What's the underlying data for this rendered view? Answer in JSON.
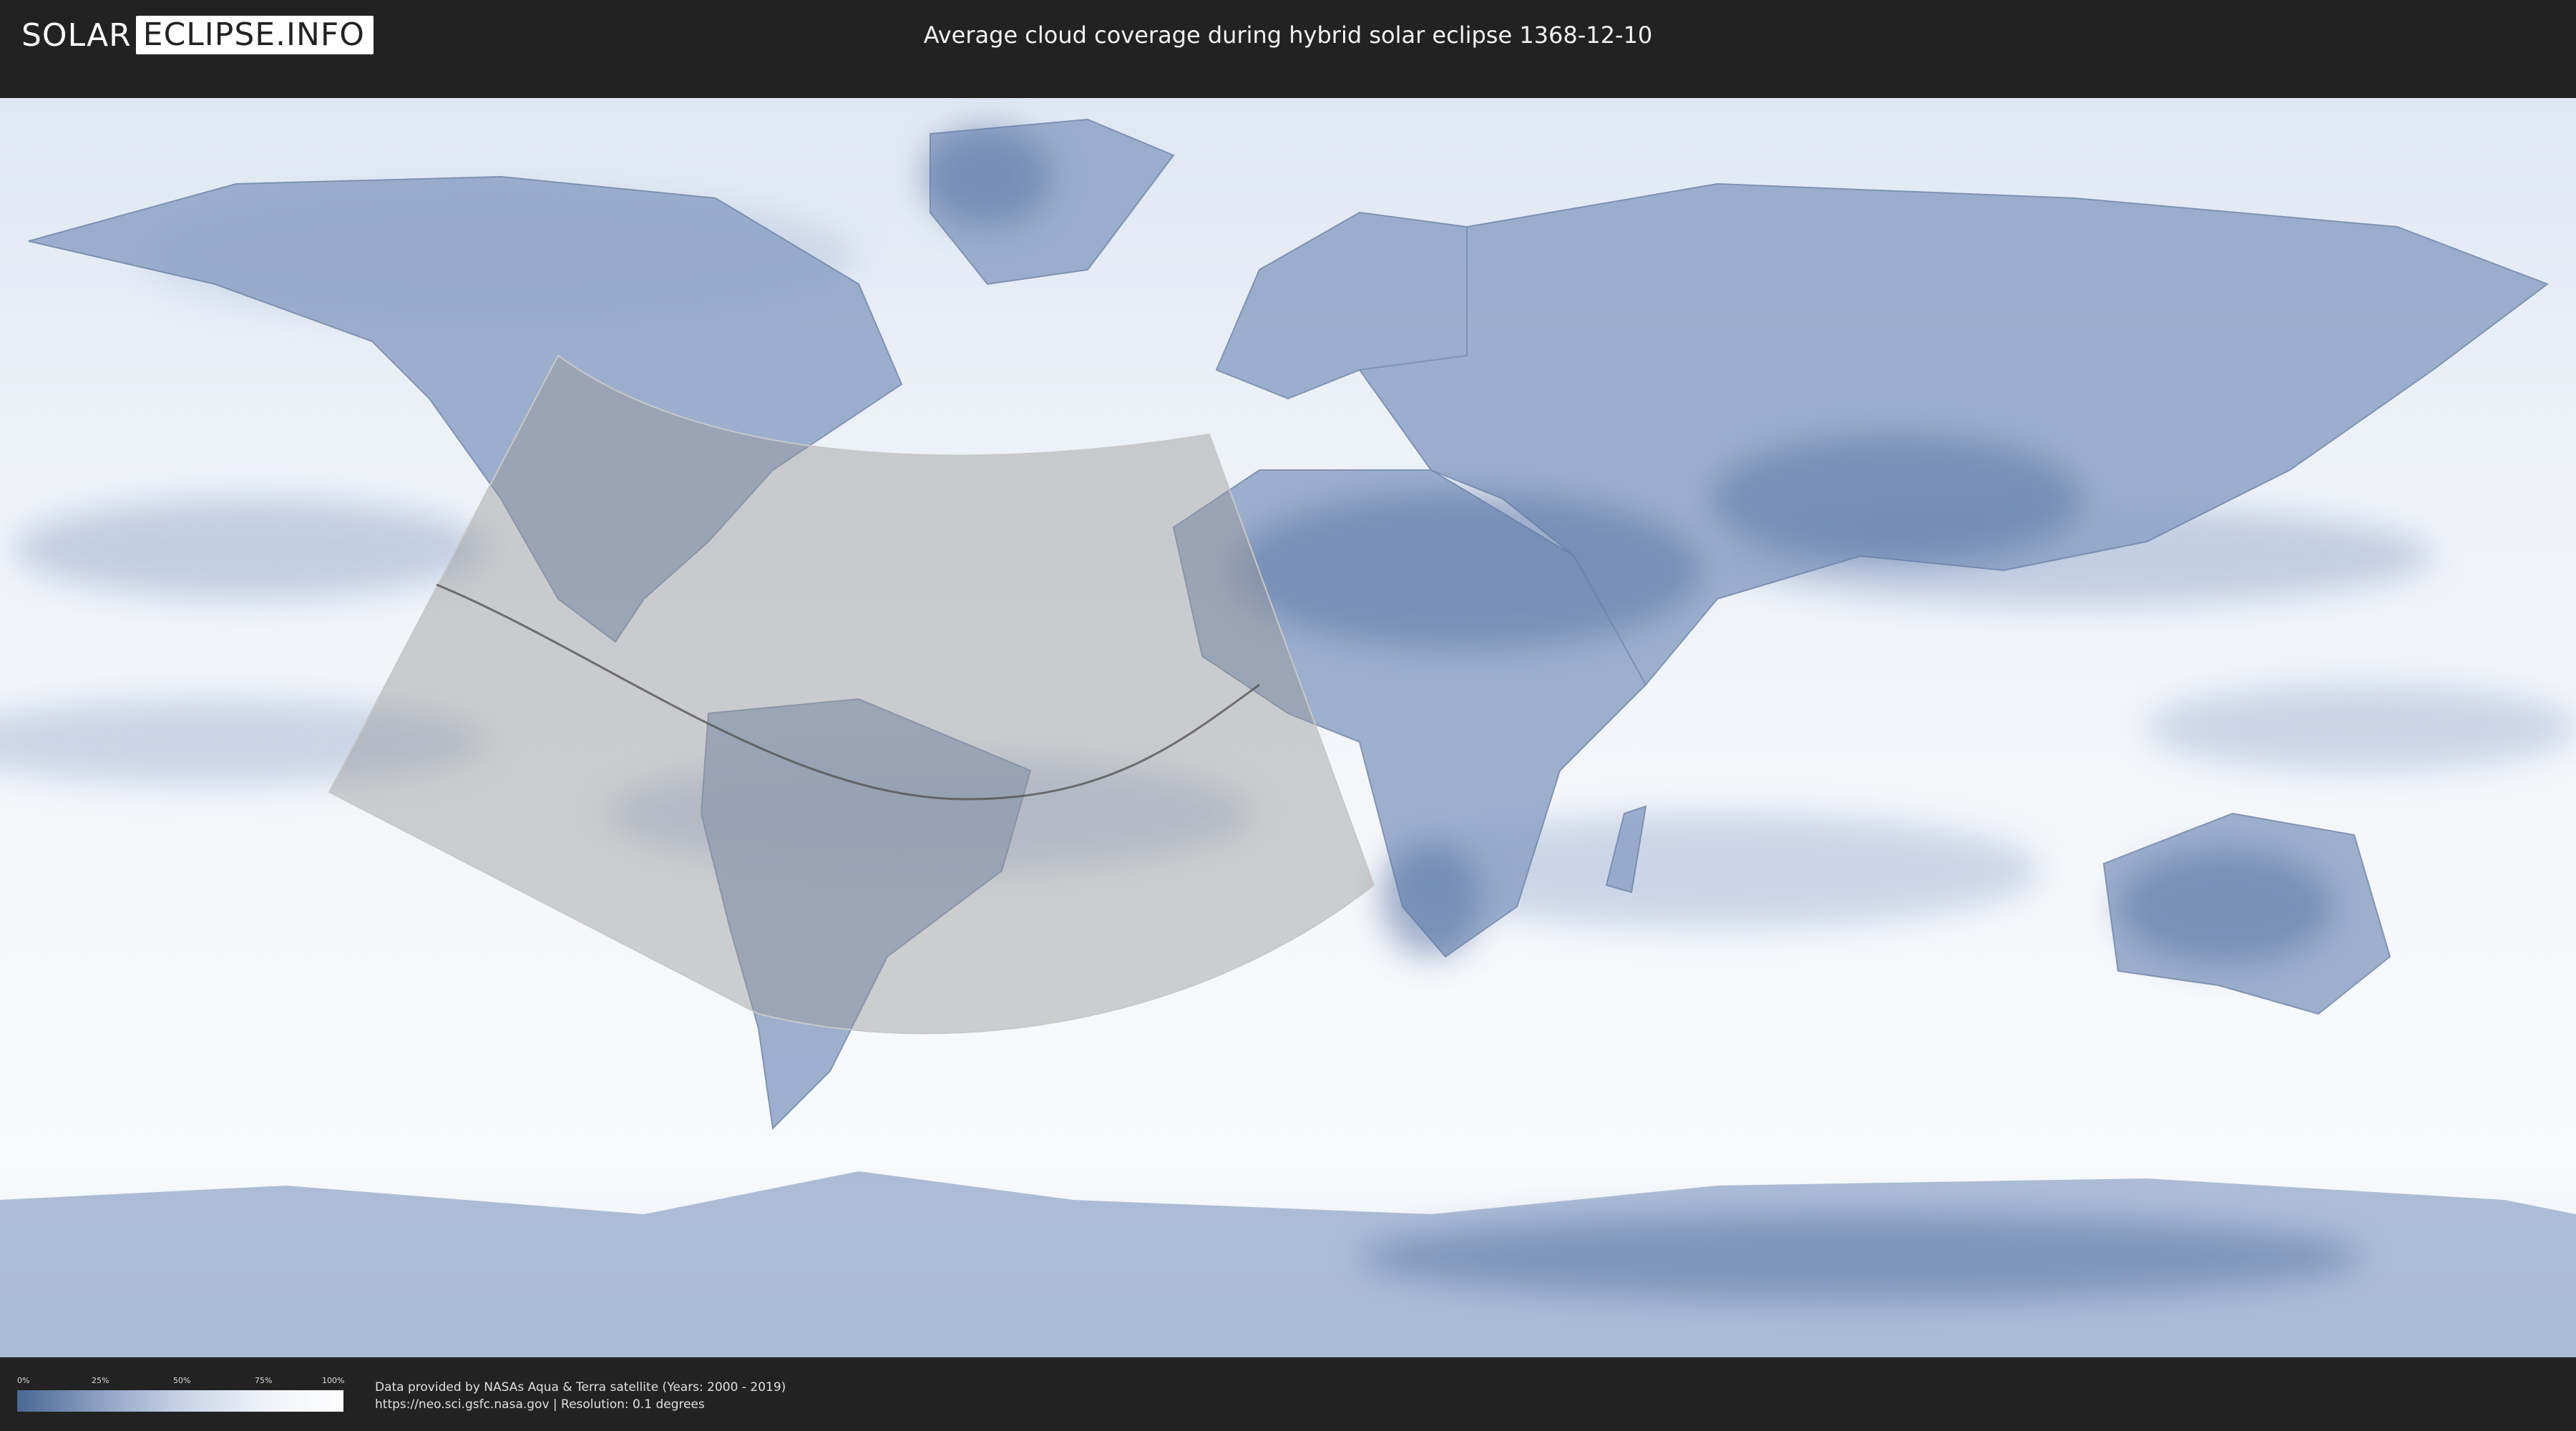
{
  "header": {
    "logo_left": "SOLAR",
    "logo_right": "ECLIPSE.INFO",
    "title": "Average cloud coverage during hybrid solar eclipse 1368-12-10"
  },
  "legend": {
    "ticks": [
      "0%",
      "25%",
      "50%",
      "75%",
      "100%"
    ],
    "colors": {
      "low": "#4a6794",
      "high": "#ffffff"
    }
  },
  "credits": {
    "line1": "Data provided by NASAs Aqua & Terra satellite (Years: 2000 - 2019)",
    "line2": "https://neo.sci.gsfc.nasa.gov | Resolution: 0.1 degrees"
  },
  "map": {
    "type": "world cloud coverage map",
    "eclipse_path": "hybrid",
    "colors": {
      "ocean_cloud": "#eef2f8",
      "clear_sky": "#5b77a6",
      "visibility_zone": "#9a9a9a"
    }
  }
}
